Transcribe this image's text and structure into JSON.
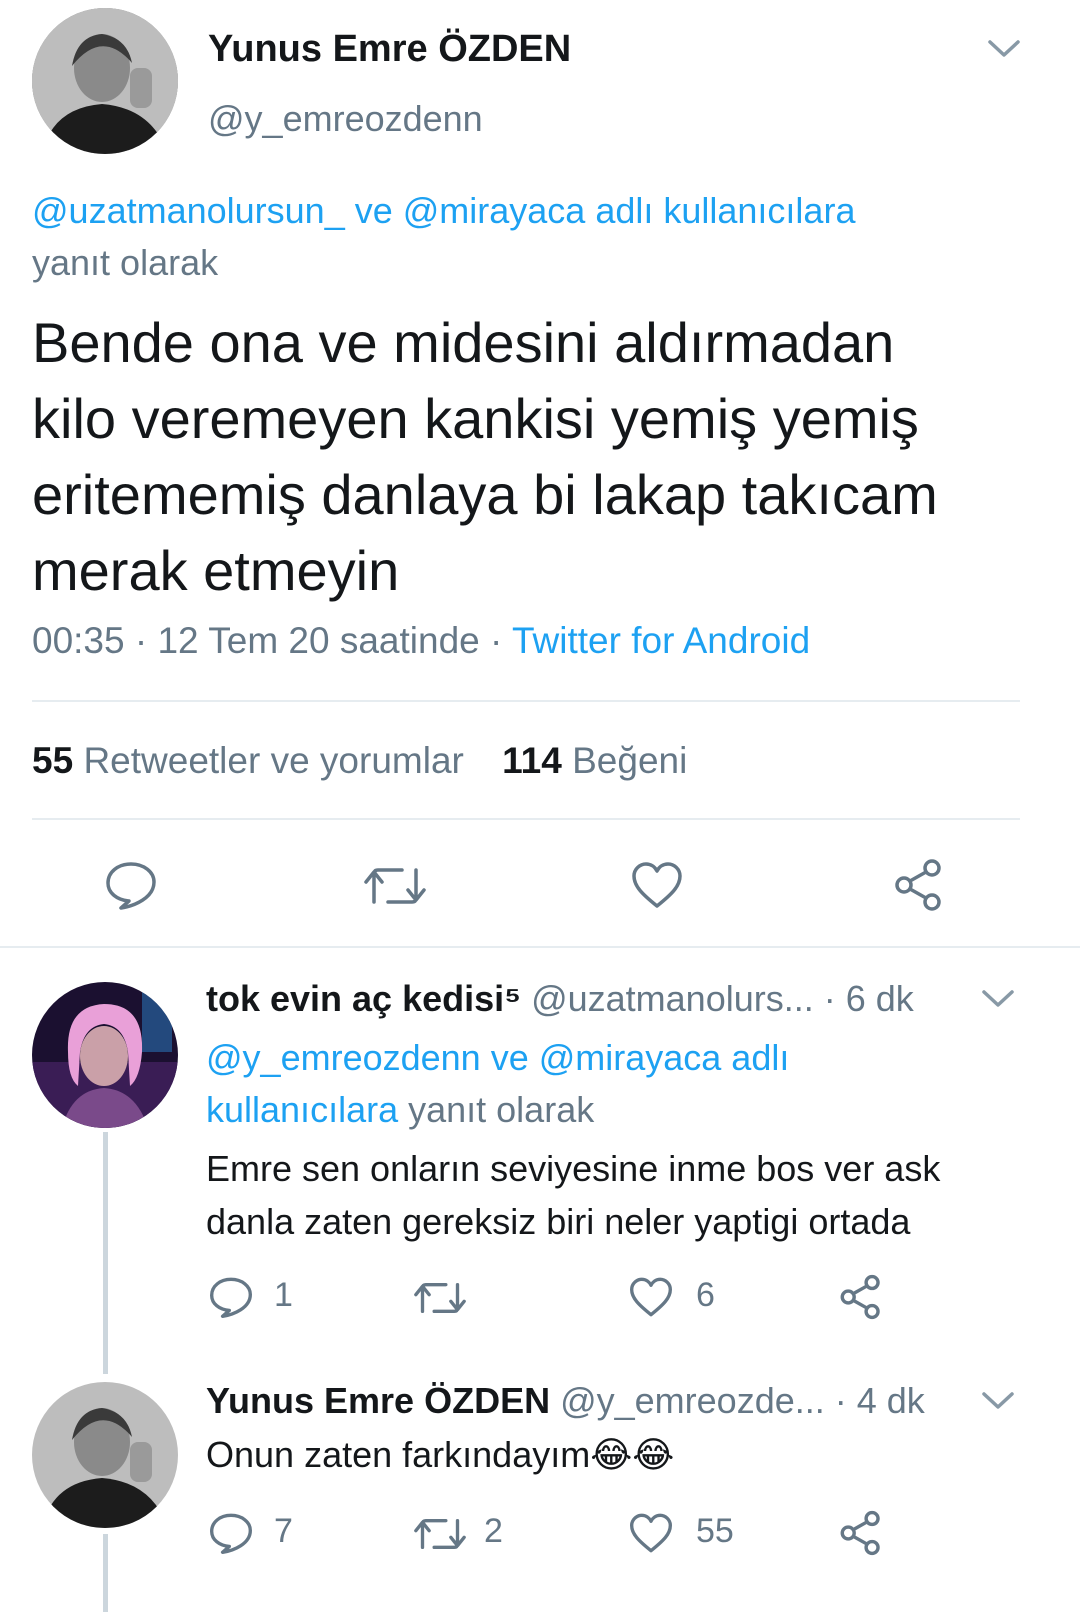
{
  "main_tweet": {
    "author_name": "Yunus Emre ÖZDEN",
    "author_handle": "@y_emreozdenn",
    "reply_to_users": "@uzatmanolursun_ ve @mirayaca adlı kullanıcılara",
    "reply_to_suffix": "yanıt olarak",
    "text_lines": [
      "Bende ona ve midesini aldırmadan",
      "kilo veremeyen kankisi yemiş yemiş",
      "eritememiş danlaya bi lakap takıcam",
      "merak etmeyin"
    ],
    "time_date": "00:35 · 12 Tem 20 saatinde ·",
    "source": "Twitter for Android",
    "retweets_count": "55",
    "retweets_label": "Retweetler ve yorumlar",
    "likes_count": "114",
    "likes_label": "Beğeni"
  },
  "replies": [
    {
      "author_name": "tok evin aç kedisi⁵",
      "author_handle": "@uzatmanolurs...",
      "time": "· 6 dk",
      "reply_to_users_line1": "@y_emreozdenn ve @mirayaca adlı",
      "reply_to_users_line2": "kullanıcılara",
      "reply_to_suffix": "yanıt olarak",
      "text_lines": [
        "Emre sen onların seviyesine inme bos ver ask",
        "danla zaten gereksiz biri neler yaptigi ortada"
      ],
      "reply_count": "1",
      "retweet_count": "",
      "like_count": "6"
    },
    {
      "author_name": "Yunus Emre ÖZDEN",
      "author_handle": "@y_emreozde...",
      "time": "· 4 dk",
      "text": "Onun zaten farkındayım😂😂",
      "reply_count": "7",
      "retweet_count": "2",
      "like_count": "55"
    }
  ],
  "icons": {
    "reply": "comment-icon",
    "retweet": "retweet-icon",
    "like": "heart-icon",
    "share": "share-icon",
    "menu": "chevron-down-icon"
  },
  "colors": {
    "link": "#1da1f2",
    "muted": "#657786",
    "text": "#14171a",
    "divider": "#e6ecf0"
  }
}
